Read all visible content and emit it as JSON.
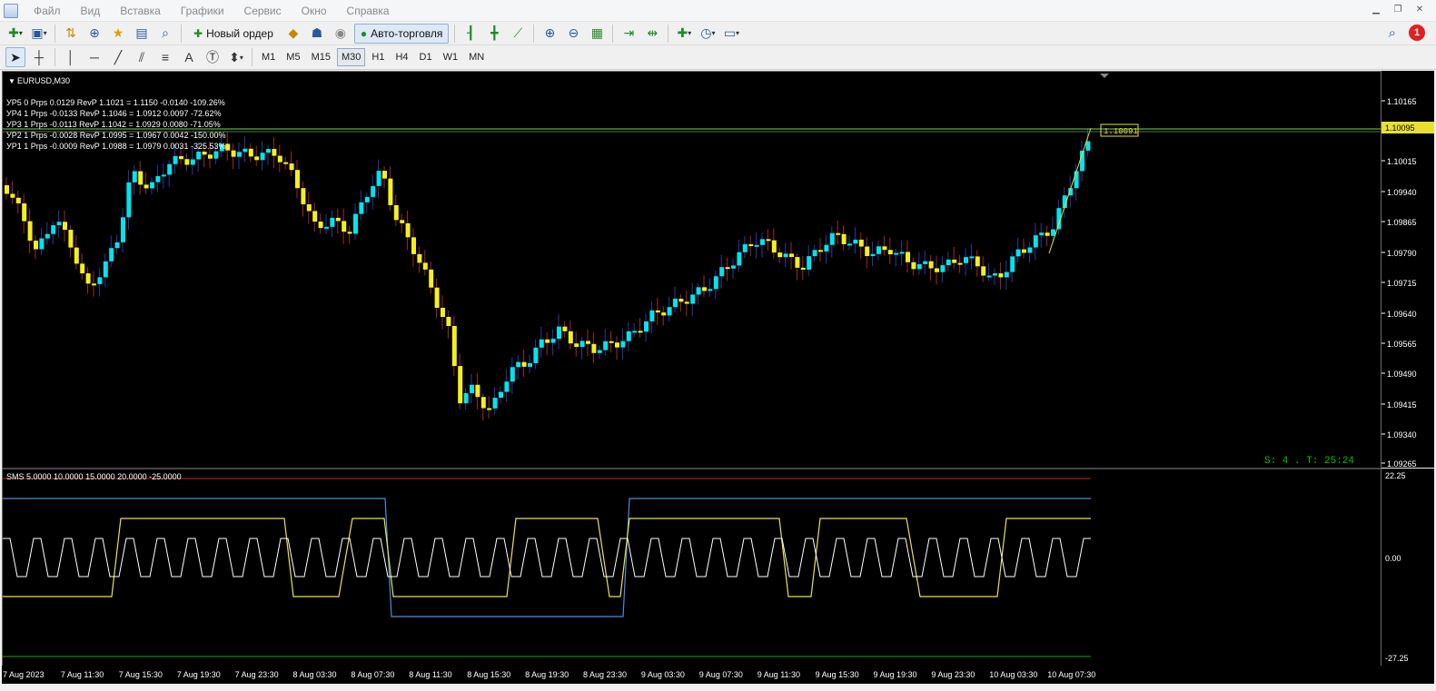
{
  "menu": [
    "Файл",
    "Вид",
    "Вставка",
    "Графики",
    "Сервис",
    "Окно",
    "Справка"
  ],
  "toolbar": {
    "new_order_label": "Новый ордер",
    "autotrade_label": "Авто-торговля",
    "notification_count": "1"
  },
  "timeframes": [
    "M1",
    "M5",
    "M15",
    "M30",
    "H1",
    "H4",
    "D1",
    "W1",
    "MN"
  ],
  "active_timeframe": "M30",
  "chart": {
    "symbol_label": "EURUSD,M30",
    "levels": [
      "УР5 0 Prps 0.0129 RevP  1.1021 = 1.1150  -0.0140   -109.26%",
      "УР4 1 Prps -0.0133 RevP  1.1046 = 1.0912  0.0097   -72.62%",
      "УР3 1 Prps -0.0113 RevP  1.1042 = 1.0929  0.0080   -71.05%",
      "УР2 1 Prps -0.0028 RevP  1.0995 = 1.0967  0.0042   -150.00%",
      "УР1 1 Prps -0.0009 RevP  1.0988 = 1.0979  0.0031   -325.53%"
    ],
    "current_price_label": "1.10095",
    "bid_box_label": "1.10091",
    "timer_label": "S: 4 . T: 25:24",
    "price_ticks": [
      "1.10165",
      "1.10015",
      "1.09940",
      "1.09865",
      "1.09790",
      "1.09715",
      "1.09640",
      "1.09565",
      "1.09490",
      "1.09415",
      "1.09340",
      "1.09265"
    ],
    "colors": {
      "bull": "#00e5f0",
      "bear": "#f5f01a",
      "level_line": "#7cd64a",
      "text": "#ffffff",
      "timer": "#00c800"
    }
  },
  "indicator": {
    "label": "SMS 5.0000 10.0000 15.0000 20.0000 -25.0000",
    "ticks": [
      "22.25",
      "0.00",
      "-27.25"
    ],
    "colors": {
      "upper": "#d02020",
      "lower": "#20a020",
      "blue": "#4a8fd8",
      "yellow": "#ebe05a",
      "white": "#ffffff"
    }
  },
  "time_ticks": [
    "7 Aug 2023",
    "7 Aug 11:30",
    "7 Aug 15:30",
    "7 Aug 19:30",
    "7 Aug 23:30",
    "8 Aug 03:30",
    "8 Aug 07:30",
    "8 Aug 11:30",
    "8 Aug 15:30",
    "8 Aug 19:30",
    "8 Aug 23:30",
    "9 Aug 03:30",
    "9 Aug 07:30",
    "9 Aug 11:30",
    "9 Aug 15:30",
    "9 Aug 19:30",
    "9 Aug 23:30",
    "10 Aug 03:30",
    "10 Aug 07:30"
  ]
}
